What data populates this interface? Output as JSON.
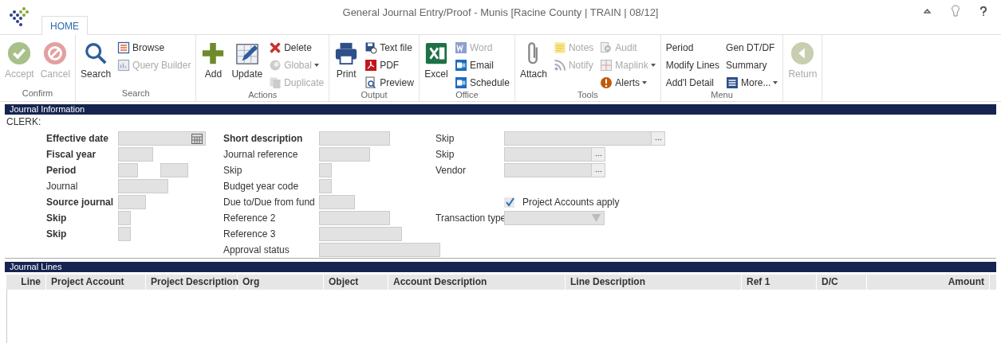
{
  "window": {
    "title": "General Journal Entry/Proof - Munis [Racine County | TRAIN | 08/12]"
  },
  "tabs": [
    {
      "label": "HOME",
      "selected": true
    }
  ],
  "ribbon": [
    {
      "label": "Confirm",
      "items": [
        {
          "kind": "large",
          "label": "Accept",
          "disabled": true
        },
        {
          "kind": "large",
          "label": "Cancel",
          "disabled": true
        }
      ]
    },
    {
      "label": "Search",
      "items": [
        {
          "kind": "large",
          "label": "Search",
          "disabled": false
        },
        {
          "kind": "small",
          "label": "Browse",
          "disabled": false
        },
        {
          "kind": "small",
          "label": "Query Builder",
          "disabled": true
        }
      ]
    },
    {
      "label": "Actions",
      "items": [
        {
          "kind": "large",
          "label": "Add",
          "disabled": false
        },
        {
          "kind": "large",
          "label": "Update",
          "disabled": false
        },
        {
          "kind": "small",
          "label": "Delete",
          "disabled": false
        },
        {
          "kind": "small",
          "label": "Global",
          "disabled": true,
          "dropdown": true
        },
        {
          "kind": "small",
          "label": "Duplicate",
          "disabled": true
        }
      ]
    },
    {
      "label": "Output",
      "items": [
        {
          "kind": "large",
          "label": "Print",
          "disabled": false
        },
        {
          "kind": "small",
          "label": "Text file",
          "disabled": false
        },
        {
          "kind": "small",
          "label": "PDF",
          "disabled": false
        },
        {
          "kind": "small",
          "label": "Preview",
          "disabled": false
        }
      ]
    },
    {
      "label": "Office",
      "items": [
        {
          "kind": "large",
          "label": "Excel",
          "disabled": false
        },
        {
          "kind": "small",
          "label": "Word",
          "disabled": true
        },
        {
          "kind": "small",
          "label": "Email",
          "disabled": false
        },
        {
          "kind": "small",
          "label": "Schedule",
          "disabled": false
        }
      ]
    },
    {
      "label": "Tools",
      "items": [
        {
          "kind": "large",
          "label": "Attach",
          "disabled": false
        },
        {
          "kind": "small",
          "label": "Notes",
          "disabled": true
        },
        {
          "kind": "small",
          "label": "Notify",
          "disabled": true
        },
        {
          "kind": "small",
          "label": "Audit",
          "disabled": true
        },
        {
          "kind": "small",
          "label": "Maplink",
          "disabled": true,
          "dropdown": true
        },
        {
          "kind": "small",
          "label": "Alerts",
          "disabled": false,
          "dropdown": true
        }
      ]
    },
    {
      "label": "Menu",
      "items": [
        {
          "kind": "text",
          "label": "Period",
          "disabled": false
        },
        {
          "kind": "text",
          "label": "Modify Lines",
          "disabled": false
        },
        {
          "kind": "text",
          "label": "Add'l Detail",
          "disabled": false
        },
        {
          "kind": "text",
          "label": "Gen DT/DF",
          "disabled": false
        },
        {
          "kind": "text",
          "label": "Summary",
          "disabled": false
        },
        {
          "kind": "small",
          "label": "More...",
          "disabled": false,
          "dropdown": true
        }
      ]
    },
    {
      "items": [
        {
          "kind": "large",
          "label": "Return",
          "disabled": true
        }
      ]
    }
  ],
  "journal_information": {
    "title": "Journal Information",
    "clerk_label": "CLERK:",
    "columns": [
      [
        {
          "label": "Effective date",
          "required": true,
          "kind": "date"
        },
        {
          "label": "Fiscal year",
          "required": true,
          "kind": "text"
        },
        {
          "label": "Period",
          "required": true,
          "kind": "pair"
        },
        {
          "label": "Journal",
          "required": false,
          "kind": "text"
        },
        {
          "label": "Source journal",
          "required": true,
          "kind": "text"
        },
        {
          "label": "Skip",
          "required": true,
          "kind": "text"
        },
        {
          "label": "Skip",
          "required": true,
          "kind": "text"
        }
      ],
      [
        {
          "label": "Short description",
          "required": true,
          "kind": "text"
        },
        {
          "label": "Journal reference",
          "required": false,
          "kind": "text"
        },
        {
          "label": "Skip",
          "required": false,
          "kind": "text"
        },
        {
          "label": "Budget year code",
          "required": false,
          "kind": "text"
        },
        {
          "label": "Due to/Due from fund",
          "required": false,
          "kind": "text"
        },
        {
          "label": "Reference 2",
          "required": false,
          "kind": "text"
        },
        {
          "label": "Reference 3",
          "required": false,
          "kind": "text"
        },
        {
          "label": "Approval status",
          "required": false,
          "kind": "text"
        }
      ],
      [
        {
          "label": "Skip",
          "required": false,
          "kind": "lookup"
        },
        {
          "label": "Skip",
          "required": false,
          "kind": "lookup"
        },
        {
          "label": "Vendor",
          "required": false,
          "kind": "lookup"
        },
        {
          "label": "Project Accounts apply",
          "required": false,
          "kind": "checkbox",
          "checked": true
        },
        {
          "label": "Transaction type",
          "required": false,
          "kind": "select"
        }
      ]
    ]
  },
  "journal_lines": {
    "title": "Journal Lines",
    "columns": [
      "Line",
      "Project Account",
      "Project Description",
      "Org",
      "Object",
      "Account Description",
      "Line Description",
      "Ref 1",
      "D/C",
      "Amount"
    ]
  }
}
